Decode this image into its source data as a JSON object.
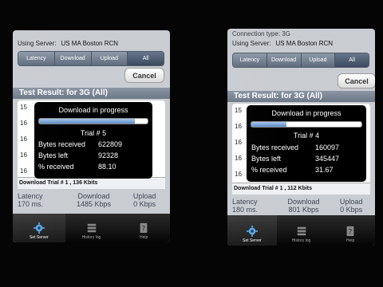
{
  "left": {
    "connection_type": "",
    "server_label": "Using Server:",
    "server_name": "US MA Boston RCN",
    "segments": [
      "Latency",
      "Download",
      "Upload",
      "All"
    ],
    "cancel_label": "Cancel",
    "result_title": "Test Result: for 3G (All)",
    "row_stubs": [
      "15",
      "16",
      "16",
      "16",
      "16"
    ],
    "overlay": {
      "title": "Download in progress",
      "progress": 0.88,
      "trial": "Trial # 5",
      "bytes_received_label": "Bytes received",
      "bytes_received": "622809",
      "bytes_left_label": "Bytes left",
      "bytes_left": "92328",
      "pct_label": "% received",
      "pct": "88.10"
    },
    "trial_line": "Download Trial # 1 , 136 Kbits",
    "stats": [
      {
        "label": "Latency",
        "value": "170 ms."
      },
      {
        "label": "Download",
        "value": "1485 Kbps"
      },
      {
        "label": "Upload",
        "value": "0 Kbps"
      }
    ],
    "tabs": [
      {
        "label": "Set Server",
        "icon": "gear-icon"
      },
      {
        "label": "History log",
        "icon": "history-icon"
      },
      {
        "label": "Help",
        "icon": "help-icon"
      }
    ]
  },
  "right": {
    "connection_type": "Connection type:  3G",
    "server_label": "Using Server:",
    "server_name": "US MA Boston RCN",
    "segments": [
      "Latency",
      "Download",
      "Upload",
      "All"
    ],
    "cancel_label": "Cancel",
    "result_title": "Test Result: for 3G (All)",
    "row_stubs": [
      "15",
      "16",
      "16",
      "16",
      "16"
    ],
    "overlay": {
      "title": "Download in progress",
      "progress": 0.32,
      "trial": "Trial # 4",
      "bytes_received_label": "Bytes received",
      "bytes_received": "160097",
      "bytes_left_label": "Bytes left",
      "bytes_left": "345447",
      "pct_label": "% received",
      "pct": "31.67"
    },
    "trial_line": "Download Trial # 1 , 112 Kbits",
    "stats": [
      {
        "label": "Latency",
        "value": "180 ms."
      },
      {
        "label": "Download",
        "value": "801 Kbps"
      },
      {
        "label": "Upload",
        "value": "0 Kbps"
      }
    ],
    "tabs": [
      {
        "label": "Set Server",
        "icon": "gear-icon"
      },
      {
        "label": "History log",
        "icon": "history-icon"
      },
      {
        "label": "Help",
        "icon": "help-icon"
      }
    ]
  }
}
